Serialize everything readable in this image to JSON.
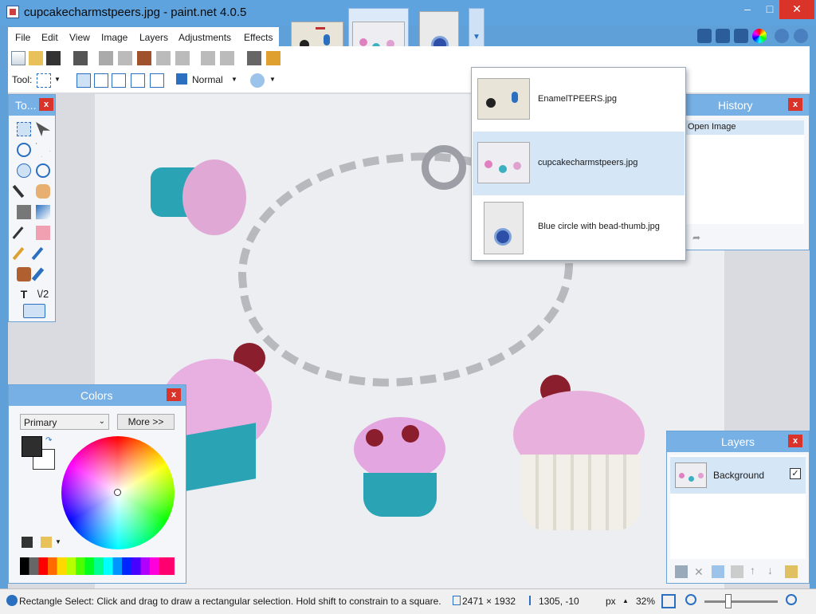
{
  "window": {
    "title": "cupcakecharmstpeers.jpg - paint.net 4.0.5",
    "minimize_symbol": "–",
    "maximize_symbol": "□",
    "close_symbol": "✕"
  },
  "menu": {
    "items": [
      "File",
      "Edit",
      "View",
      "Image",
      "Layers",
      "Adjustments",
      "Effects"
    ]
  },
  "toolbar": {
    "tool_label": "Tool:",
    "blend_mode": "Normal"
  },
  "open_images": {
    "thumbnails": [
      "EnamelTPEERS.jpg",
      "cupcakecharmstpeers.jpg",
      "Blue circle with bead-thumb.jpg"
    ],
    "dropdown_items": [
      {
        "name": "EnamelTPEERS.jpg",
        "active": false
      },
      {
        "name": "cupcakecharmstpeers.jpg",
        "active": true
      },
      {
        "name": "Blue circle with bead-thumb.jpg",
        "active": false
      }
    ]
  },
  "tools_panel": {
    "title": "To...",
    "close": "x"
  },
  "history_panel": {
    "title": "History",
    "close": "x",
    "items": [
      "Open Image"
    ]
  },
  "colors_panel": {
    "title": "Colors",
    "close": "x",
    "palette_select": "Primary",
    "more_button": "More >>"
  },
  "layers_panel": {
    "title": "Layers",
    "close": "x",
    "layers": [
      {
        "name": "Background",
        "visible": true
      }
    ]
  },
  "status_bar": {
    "hint": "Rectangle Select: Click and drag to draw a rectangular selection. Hold shift to constrain to a square.",
    "image_size": "2471 × 1932",
    "cursor_pos": "1305, -10",
    "units": "px",
    "zoom": "32%"
  },
  "colors": {
    "title_bar": "#5ea3dd",
    "panel_header": "#76b0e4",
    "close_button": "#d9332a",
    "selected_item": "#d5e6f7"
  }
}
